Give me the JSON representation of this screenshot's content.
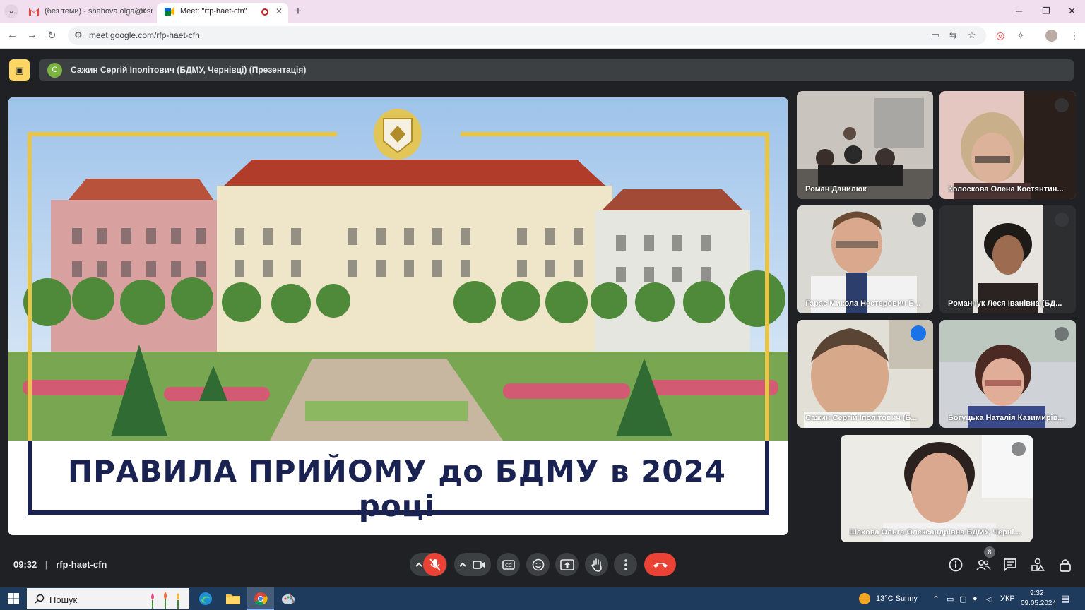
{
  "browser": {
    "tabs": [
      {
        "title": "(без теми) - shahova.olga@bsm",
        "active": false
      },
      {
        "title": "Meet: \"rfp-haet-cfn\"",
        "active": true
      }
    ],
    "url": "meet.google.com/rfp-haet-cfn"
  },
  "presentation": {
    "presenter_initial": "С",
    "presenter_label": "Сажин Сергій Іполітович (БДМУ, Чернівці) (Презентація)",
    "slide_title": "ПРАВИЛА ПРИЙОМУ до БДМУ в 2024 році"
  },
  "participants": [
    {
      "name": "Роман Данилюк",
      "muted": false,
      "speaking": false
    },
    {
      "name": "Колоскова Олена Костянтин...",
      "muted": true,
      "speaking": false
    },
    {
      "name": "Гарас Микола Нестерович Б...",
      "muted": true,
      "speaking": false
    },
    {
      "name": "Романчук Леся Іванівна (БД...",
      "muted": true,
      "speaking": false
    },
    {
      "name": "Сажин Сергій Іполітович (Б...",
      "muted": false,
      "speaking": true
    },
    {
      "name": "Богуцька Наталія Казимирів...",
      "muted": true,
      "speaking": false
    },
    {
      "name": "Шахова Ольга Олександрівна БДМУ, Черні...",
      "muted": true,
      "speaking": false
    }
  ],
  "meeting": {
    "time": "09:32",
    "separator": "|",
    "code": "rfp-haet-cfn",
    "participant_count": "8"
  },
  "taskbar": {
    "search_label": "Пошук",
    "weather": "13°C  Sunny",
    "language": "УКР",
    "clock_time": "9:32",
    "clock_date": "09.05.2024"
  },
  "colors": {
    "meet_bg": "#202124",
    "hangup_red": "#ea4335",
    "mic_off_red": "#ea4335",
    "slide_title_navy": "#1a2251",
    "frame_gold": "#e8c547",
    "speaker_highlight": "#8ab4f8"
  }
}
